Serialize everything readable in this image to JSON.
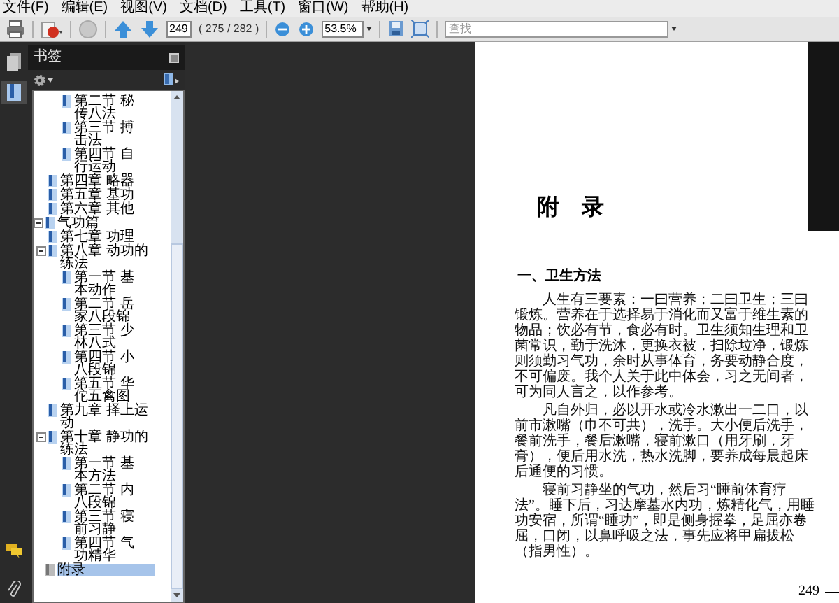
{
  "menu": [
    "文件(F)",
    "编辑(E)",
    "视图(V)",
    "文档(D)",
    "工具(T)",
    "窗口(W)",
    "帮助(H)"
  ],
  "toolbar": {
    "page_number": "249",
    "page_count": "( 275 / 282 )",
    "zoom": "53.5%",
    "search": {
      "placeholder": "查找"
    }
  },
  "side_tabs": [
    {
      "kind": "pages",
      "selected": false
    },
    {
      "kind": "bookmarks",
      "selected": true
    }
  ],
  "bookmarks_panel": {
    "title": "书签",
    "tree": [
      {
        "children": [
          {
            "children": [
              {
                "label": "第二节 秘传八法",
                "selected": false
              },
              {
                "label": "第三节 搏击法",
                "selected": false
              },
              {
                "label": "第四节 自行运动",
                "selected": false
              }
            ]
          },
          {
            "label": "第四章 略器",
            "selected": false
          },
          {
            "label": "第五章 基功",
            "selected": false
          },
          {
            "label": "第六章 其他",
            "selected": false
          }
        ]
      },
      {
        "label": "气功篇",
        "selected": false,
        "expanded": true,
        "children": [
          {
            "label": "第七章 功理",
            "selected": false
          },
          {
            "label": "第八章 动功的练法",
            "selected": false,
            "expanded": true,
            "children": [
              {
                "label": "第一节 基本动作",
                "selected": false
              },
              {
                "label": "第二节 岳家八段锦",
                "selected": false
              },
              {
                "label": "第三节 少林八式",
                "selected": false
              },
              {
                "label": "第四节 小八段锦",
                "selected": false
              },
              {
                "label": "第五节 华佗五禽图",
                "selected": false
              }
            ]
          },
          {
            "label": "第九章 择上运动",
            "selected": false
          },
          {
            "label": "第十章 静功的练法",
            "selected": false,
            "expanded": true,
            "children": [
              {
                "label": "第一节 基本方法",
                "selected": false
              },
              {
                "label": "第二节 内八段锦",
                "selected": false
              },
              {
                "label": "第三节 寝前习静",
                "selected": false
              },
              {
                "label": "第四节 气功精华",
                "selected": false
              }
            ]
          }
        ]
      },
      {
        "label": "附录",
        "selected": true
      }
    ]
  },
  "page": {
    "title": "附 录",
    "heading": "一、卫生方法",
    "paragraphs": [
      "人生有三要素：一曰营养；二曰卫生；三曰锻炼。营养在于选择易于消化而又富于维生素的物品；饮必有节，食必有时。卫生须知生理和卫菌常识，勤于洗沐，更换衣被，扫除垃净，锻炼则须勤习气功，余时从事体育，务要动静合度，不可偏废。我个人关于此中体会，习之无间者，可为同人言之，以作参考。",
      "凡自外归，必以开水或冷水漱出一二口，以前市漱嘴（巾不可共），洗手。大小便后洗手，餐前洗手，餐后漱嘴，寝前漱口（用牙刷，牙膏），便后用水洗，热水洗脚，要养成每晨起床后通便的习惯。",
      "寝前习静坐的气功，然后习“睡前体育疗法”。睡下后，习达摩墓水内功，炼精化气，用睡功安宿，所谓“睡功”，即是侧身握拳，足屈亦卷屈，口闭，以鼻呼吸之法，事先应将甲扁拔松（指男性）。"
    ],
    "page_number": "249"
  }
}
